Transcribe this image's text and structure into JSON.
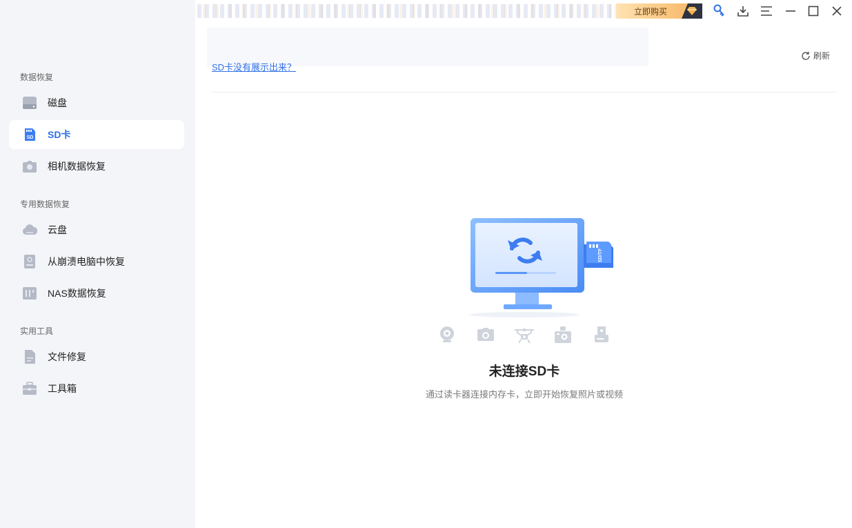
{
  "topbar": {
    "buy_label": "立即购买"
  },
  "sidebar": {
    "sections": [
      {
        "label": "数据恢复"
      },
      {
        "label": "专用数据恢复"
      },
      {
        "label": "实用工具"
      }
    ],
    "items": [
      {
        "label": "磁盘",
        "icon": "disk-icon"
      },
      {
        "label": "SD卡",
        "icon": "sd-card-icon",
        "active": true
      },
      {
        "label": "相机数据恢复",
        "icon": "camera-icon"
      },
      {
        "label": "云盘",
        "icon": "cloud-icon"
      },
      {
        "label": "从崩溃电脑中恢复",
        "icon": "crashed-pc-icon"
      },
      {
        "label": "NAS数据恢复",
        "icon": "nas-icon"
      },
      {
        "label": "文件修复",
        "icon": "file-repair-icon"
      },
      {
        "label": "工具箱",
        "icon": "toolbox-icon"
      }
    ]
  },
  "main": {
    "sd_link": "SD卡没有展示出来？",
    "refresh_label": "刷新",
    "empty_title": "未连接SD卡",
    "empty_subtitle": "通过读卡器连接内存卡，立即开始恢复照片或视频",
    "illustration_card_label": "SD/TF"
  },
  "colors": {
    "accent": "#2f6fe8",
    "sidebar_bg": "#f4f5f8",
    "icon_gray": "#b4bac6"
  }
}
